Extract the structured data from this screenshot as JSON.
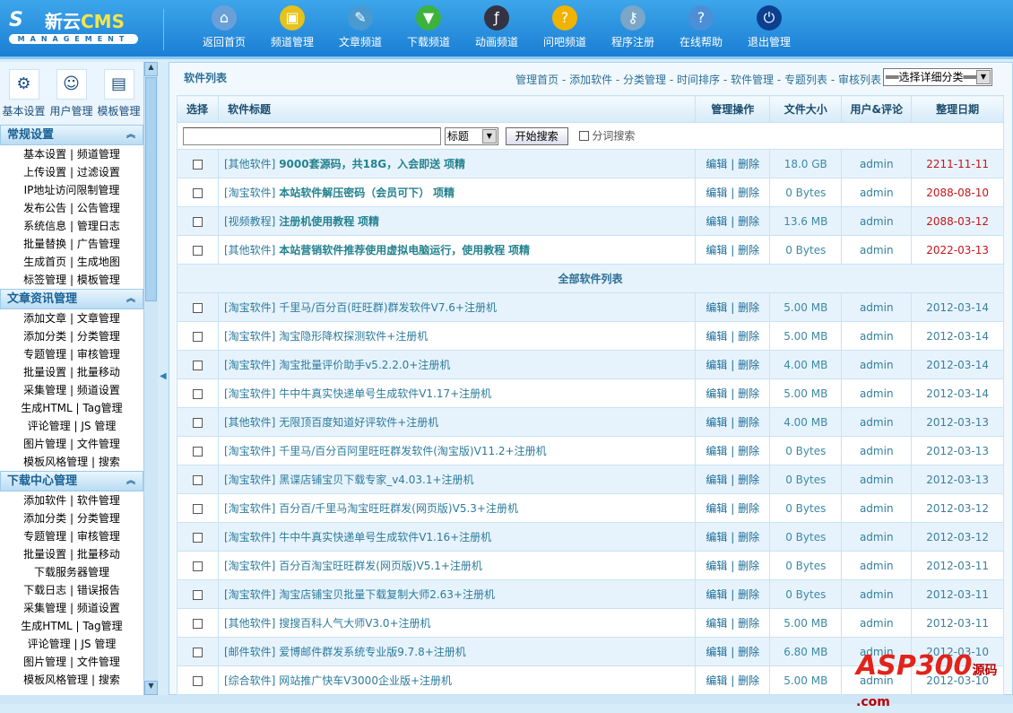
{
  "logo": {
    "brand": "新云",
    "cms": "CMS",
    "sub": "MANAGEMENT"
  },
  "nav": [
    {
      "label": "返回首页",
      "icon": "home-icon",
      "color": "#6aa0d8",
      "glyph": "⌂"
    },
    {
      "label": "频道管理",
      "icon": "monitor-icon",
      "color": "#e6c21a",
      "glyph": "▣"
    },
    {
      "label": "文章频道",
      "icon": "article-icon",
      "color": "#4a9ad0",
      "glyph": "✎"
    },
    {
      "label": "下载频道",
      "icon": "download-icon",
      "color": "#3cb33c",
      "glyph": "▼"
    },
    {
      "label": "动画频道",
      "icon": "flash-icon",
      "color": "#334",
      "glyph": "ƒ"
    },
    {
      "label": "问吧频道",
      "icon": "question-coin-icon",
      "color": "#f0b400",
      "glyph": "?"
    },
    {
      "label": "程序注册",
      "icon": "keys-icon",
      "color": "#7aa6c8",
      "glyph": "⚷"
    },
    {
      "label": "在线帮助",
      "icon": "help-icon",
      "color": "#4d8fd6",
      "glyph": "?"
    },
    {
      "label": "退出管理",
      "icon": "power-icon",
      "color": "#0c3f8f",
      "glyph": "⏻"
    }
  ],
  "sidebar": {
    "shortcuts": [
      {
        "label": "基本设置",
        "icon": "gears-icon",
        "glyph": "⚙"
      },
      {
        "label": "用户管理",
        "icon": "users-icon",
        "glyph": "☺"
      },
      {
        "label": "模板管理",
        "icon": "template-icon",
        "glyph": "▤"
      }
    ],
    "sections": [
      {
        "title": "常规设置",
        "items": [
          "基本设置 | 频道管理",
          "上传设置 | 过滤设置",
          "IP地址访问限制管理",
          "发布公告 | 公告管理",
          "系统信息 | 管理日志",
          "批量替换 | 广告管理",
          "生成首页 | 生成地图",
          "标签管理 | 模板管理"
        ]
      },
      {
        "title": "文章资讯管理",
        "items": [
          "添加文章 | 文章管理",
          "添加分类 | 分类管理",
          "专题管理 | 审核管理",
          "批量设置 | 批量移动",
          "采集管理 | 频道设置",
          "生成HTML | Tag管理",
          "评论管理 | JS 管理",
          "图片管理 | 文件管理",
          "模板风格管理 | 搜索"
        ]
      },
      {
        "title": "下载中心管理",
        "items": [
          "添加软件 | 软件管理",
          "添加分类 | 分类管理",
          "专题管理 | 审核管理",
          "批量设置 | 批量移动",
          "下载服务器管理",
          "下载日志 | 错误报告",
          "采集管理 | 频道设置",
          "生成HTML | Tag管理",
          "评论管理 | JS 管理",
          "图片管理 | 文件管理",
          "模板风格管理 | 搜索"
        ]
      }
    ]
  },
  "main": {
    "title": "软件列表",
    "links": [
      "管理首页",
      "添加软件",
      "分类管理",
      "时间排序",
      "软件管理",
      "专题列表",
      "审核列表"
    ],
    "category_select": "══选择详细分类══",
    "columns": [
      "选择",
      "软件标题",
      "管理操作",
      "文件大小",
      "用户&评论",
      "整理日期"
    ],
    "search": {
      "value": "",
      "field": "标题",
      "button": "开始搜索",
      "split_label": "分词搜索"
    },
    "ops": {
      "edit": "编辑",
      "delete": "删除"
    },
    "top_rows": [
      {
        "cat": "[其他软件]",
        "title": "9000套源码，共18G，入会即送",
        "flag": "项精",
        "size": "18.0 GB",
        "user": "admin",
        "date": "2211-11-11"
      },
      {
        "cat": "[淘宝软件]",
        "title": "本站软件解压密码（会员可下）",
        "flag": "项精",
        "size": "0 Bytes",
        "user": "admin",
        "date": "2088-08-10"
      },
      {
        "cat": "[视频教程]",
        "title": "注册机使用教程",
        "flag": "项精",
        "size": "13.6 MB",
        "user": "admin",
        "date": "2088-03-12"
      },
      {
        "cat": "[其他软件]",
        "title": "本站营销软件推荐使用虚拟电脑运行，使用教程",
        "flag": "项精",
        "size": "0 Bytes",
        "user": "admin",
        "date": "2022-03-13"
      }
    ],
    "all_label": "全部软件列表",
    "rows": [
      {
        "cat": "[淘宝软件]",
        "title": "千里马/百分百(旺旺群)群发软件V7.6+注册机",
        "size": "5.00 MB",
        "user": "admin",
        "date": "2012-03-14"
      },
      {
        "cat": "[淘宝软件]",
        "title": "淘宝隐形降权探测软件+注册机",
        "size": "5.00 MB",
        "user": "admin",
        "date": "2012-03-14"
      },
      {
        "cat": "[淘宝软件]",
        "title": "淘宝批量评价助手v5.2.2.0+注册机",
        "size": "4.00 MB",
        "user": "admin",
        "date": "2012-03-14"
      },
      {
        "cat": "[淘宝软件]",
        "title": "牛中牛真实快递单号生成软件V1.17+注册机",
        "size": "5.00 MB",
        "user": "admin",
        "date": "2012-03-14"
      },
      {
        "cat": "[其他软件]",
        "title": "无限顶百度知道好评软件+注册机",
        "size": "4.00 MB",
        "user": "admin",
        "date": "2012-03-13"
      },
      {
        "cat": "[淘宝软件]",
        "title": "千里马/百分百阿里旺旺群发软件(淘宝版)V11.2+注册机",
        "size": "0 Bytes",
        "user": "admin",
        "date": "2012-03-13"
      },
      {
        "cat": "[淘宝软件]",
        "title": "黑谍店铺宝贝下载专家_v4.03.1+注册机",
        "size": "0 Bytes",
        "user": "admin",
        "date": "2012-03-13"
      },
      {
        "cat": "[淘宝软件]",
        "title": "百分百/千里马淘宝旺旺群发(网页版)V5.3+注册机",
        "size": "0 Bytes",
        "user": "admin",
        "date": "2012-03-12"
      },
      {
        "cat": "[淘宝软件]",
        "title": "牛中牛真实快递单号生成软件V1.16+注册机",
        "size": "0 Bytes",
        "user": "admin",
        "date": "2012-03-12"
      },
      {
        "cat": "[淘宝软件]",
        "title": "百分百淘宝旺旺群发(网页版)V5.1+注册机",
        "size": "0 Bytes",
        "user": "admin",
        "date": "2012-03-11"
      },
      {
        "cat": "[淘宝软件]",
        "title": "淘宝店铺宝贝批量下载复制大师2.63+注册机",
        "size": "0 Bytes",
        "user": "admin",
        "date": "2012-03-11"
      },
      {
        "cat": "[其他软件]",
        "title": "搜搜百科人气大师V3.0+注册机",
        "size": "5.00 MB",
        "user": "admin",
        "date": "2012-03-11"
      },
      {
        "cat": "[邮件软件]",
        "title": "爱博邮件群发系统专业版9.7.8+注册机",
        "size": "6.80 MB",
        "user": "admin",
        "date": "2012-03-10"
      },
      {
        "cat": "[综合软件]",
        "title": "网站推广快车V3000企业版+注册机",
        "size": "5.00 MB",
        "user": "admin",
        "date": "2012-03-10"
      }
    ]
  },
  "watermark": {
    "text": "ASP300",
    "sub": "源码 .com"
  }
}
